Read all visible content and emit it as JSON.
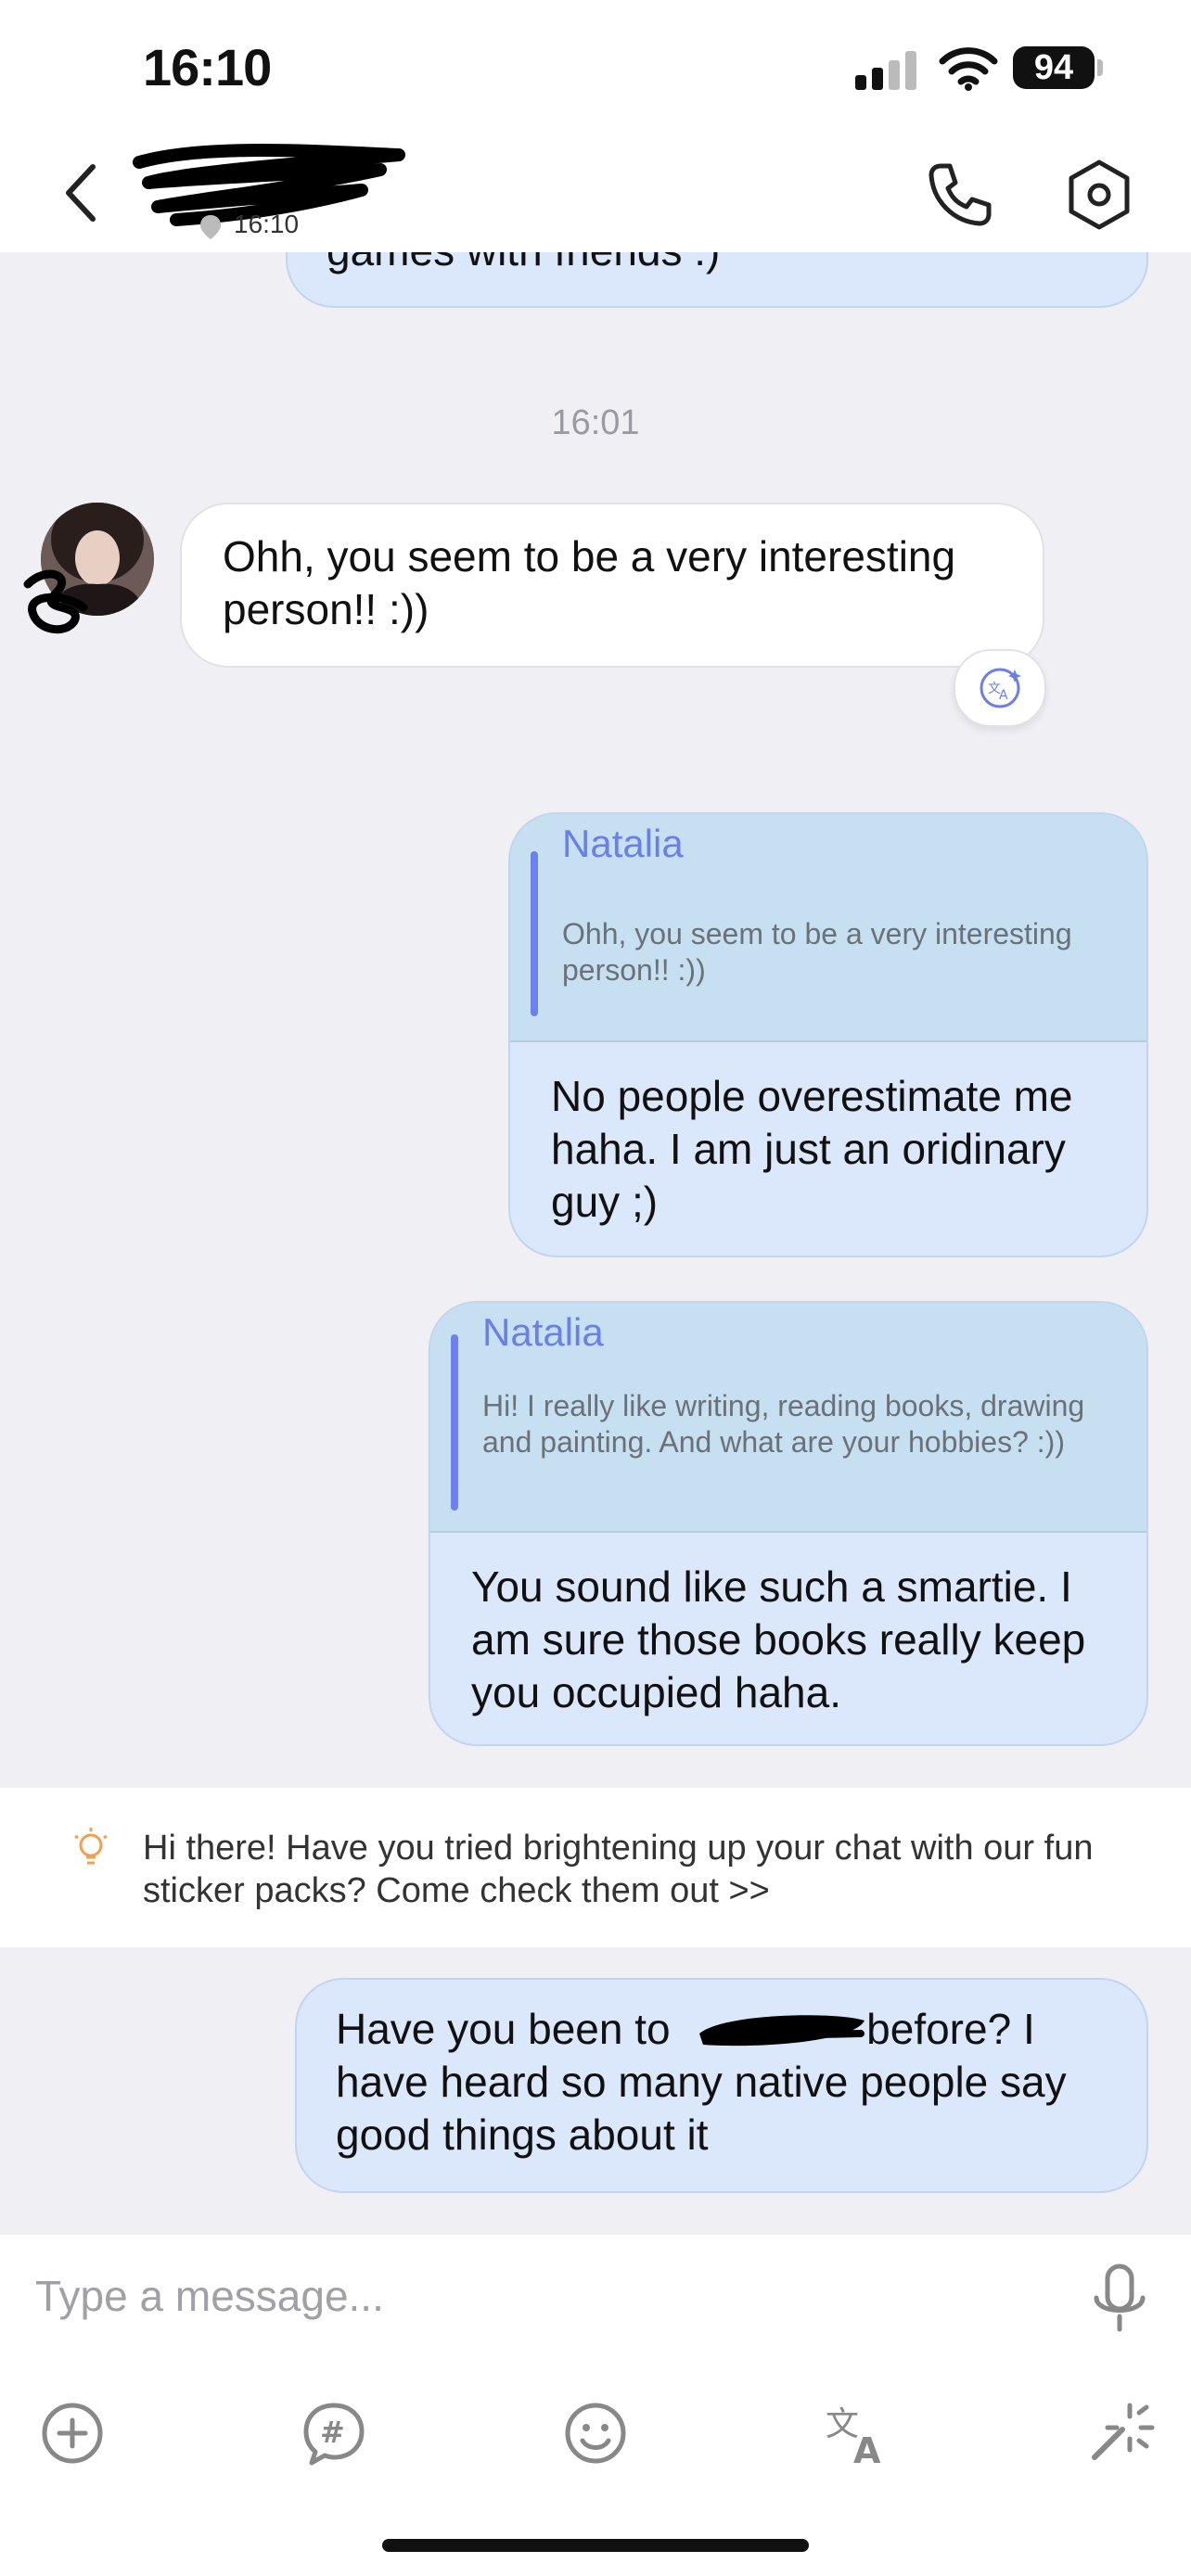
{
  "status_bar": {
    "time": "16:10",
    "battery": "94"
  },
  "header": {
    "last_seen": "16:10"
  },
  "chat": {
    "previous_message_text": "games with friends :)",
    "time_divider": "16:01",
    "messages": [
      {
        "type": "received",
        "text": "Ohh, you seem to be a very interesting person!! :))"
      },
      {
        "type": "sent",
        "quote_author": "Natalia",
        "quote_text": "Ohh, you seem to be a very interesting person!! :))",
        "text": "No people overestimate me haha. I am just an oridinary guy ;)"
      },
      {
        "type": "sent",
        "quote_author": "Natalia",
        "quote_text": "Hi! I really like writing, reading books, drawing and painting. And what are your hobbies? :))",
        "text": "You sound like such a smartie. I am sure those books really keep you occupied haha."
      },
      {
        "type": "sent",
        "text_before": "Have you been to ",
        "text_after": " before? I have heard so many native people say good things about it"
      }
    ]
  },
  "tip": {
    "text": "Hi there! Have you tried brightening up your chat with our fun sticker packs? Come check them out >>"
  },
  "composer": {
    "placeholder": "Type a message..."
  },
  "icons": [
    "back-icon",
    "phone-icon",
    "settings-icon",
    "translate-icon",
    "lightbulb-icon",
    "mic-icon",
    "add-icon",
    "hashtag-icon",
    "emoji-icon",
    "translate-icon",
    "magic-icon"
  ],
  "colors": {
    "sent_bubble": "#dbe7fb",
    "quote_block": "#c6dff1",
    "quote_accent": "#6f7ff0",
    "background": "#efeff4",
    "tip_icon": "#f0a050"
  }
}
